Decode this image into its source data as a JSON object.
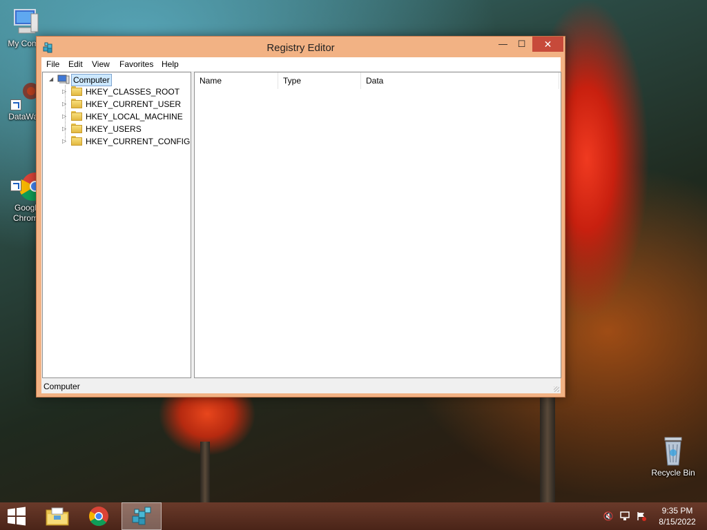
{
  "desktop": {
    "icons": [
      {
        "label": "My Comp",
        "icon": "computer-icon"
      },
      {
        "label": "DataWag",
        "icon": "datawag-icon"
      },
      {
        "label": "Googl\nChrom",
        "icon": "chrome-icon"
      },
      {
        "label": "Recycle Bin",
        "icon": "recycle-bin-icon"
      }
    ]
  },
  "window": {
    "title": "Registry Editor",
    "controls": {
      "minimize": "—",
      "maximize": "☐",
      "close": "✕"
    },
    "menu": [
      "File",
      "Edit",
      "View",
      "Favorites",
      "Help"
    ],
    "tree": {
      "root": {
        "label": "Computer",
        "expanded": true,
        "selected": true
      },
      "children": [
        "HKEY_CLASSES_ROOT",
        "HKEY_CURRENT_USER",
        "HKEY_LOCAL_MACHINE",
        "HKEY_USERS",
        "HKEY_CURRENT_CONFIG"
      ]
    },
    "list_columns": [
      "Name",
      "Type",
      "Data"
    ],
    "status": "Computer"
  },
  "taskbar": {
    "apps": [
      {
        "name": "File Explorer",
        "icon": "file-explorer-icon",
        "active": false
      },
      {
        "name": "Google Chrome",
        "icon": "chrome-icon",
        "active": false
      },
      {
        "name": "Registry Editor",
        "icon": "regedit-icon",
        "active": true
      }
    ],
    "tray": [
      "volume-muted-icon",
      "network-icon",
      "action-center-icon"
    ],
    "clock": {
      "time": "9:35 PM",
      "date": "8/15/2022"
    }
  },
  "colors": {
    "window_frame": "#f2b284",
    "close_button": "#c74a3a",
    "selection": "#cce8ff"
  }
}
